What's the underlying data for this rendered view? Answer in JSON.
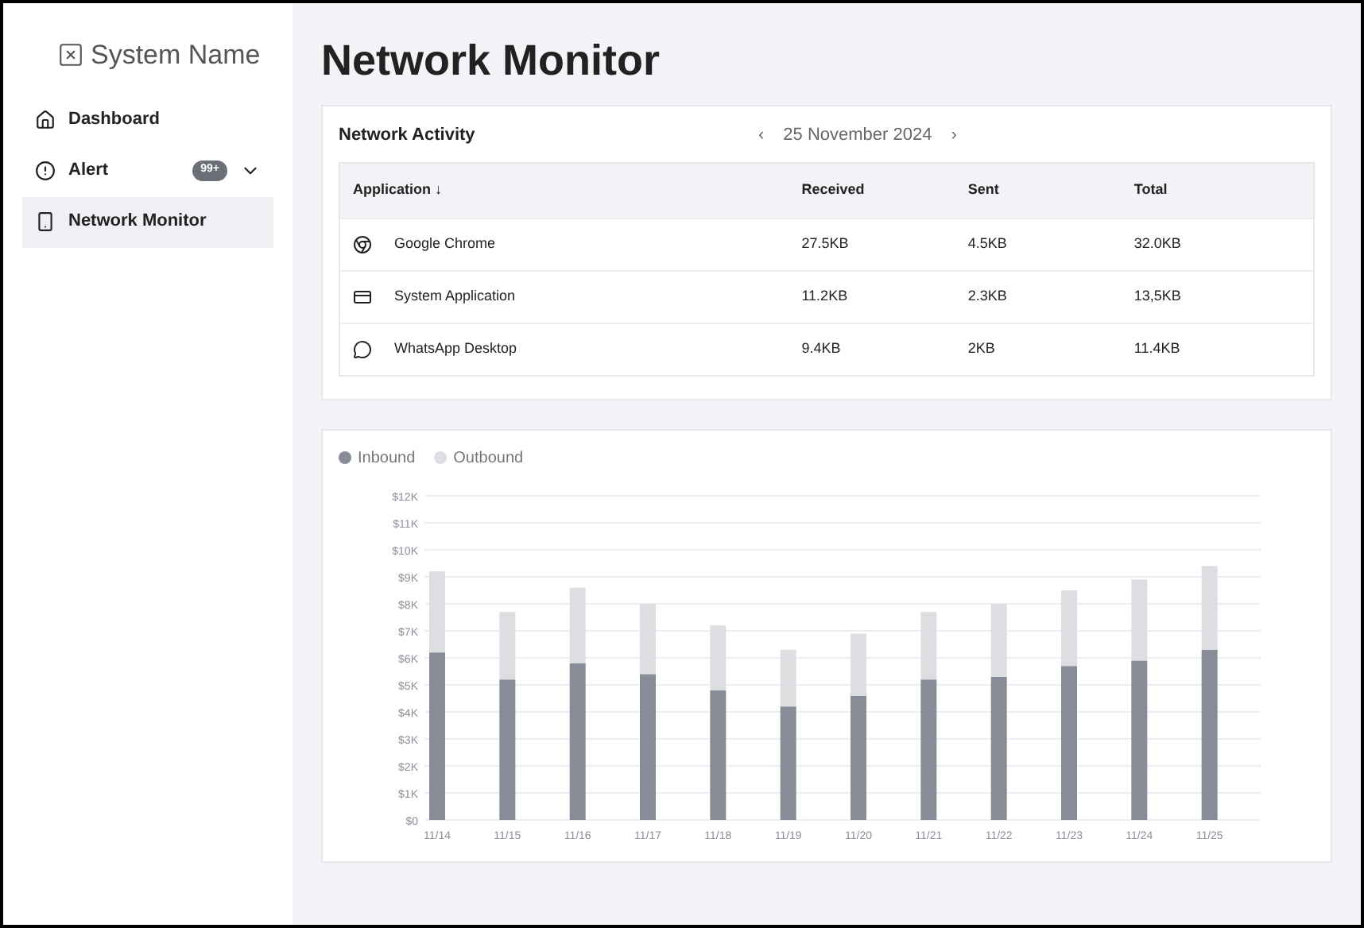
{
  "sidebar": {
    "brand": "System Name",
    "items": [
      {
        "kind": "home",
        "label": "Dashboard",
        "selected": false
      },
      {
        "kind": "alert",
        "label": "Alert",
        "badge": "99+",
        "expanded": false,
        "selected": false
      },
      {
        "kind": "monitor",
        "label": "Network Monitor",
        "selected": true
      }
    ]
  },
  "page_title": "Network Monitor",
  "activity": {
    "title": "Network Activity",
    "date": "25 November 2024",
    "prev": "‹",
    "next": "›",
    "columns": [
      {
        "label": "Application",
        "sort": "↓"
      },
      {
        "label": "Received"
      },
      {
        "label": "Sent"
      },
      {
        "label": "Total"
      }
    ],
    "rows": [
      {
        "kind": "browser",
        "cells": [
          "Google Chrome",
          "27.5KB",
          "4.5KB",
          "32.0KB"
        ]
      },
      {
        "kind": "system",
        "cells": [
          "System Application",
          "11.2KB",
          "2.3KB",
          "13,5KB"
        ]
      },
      {
        "kind": "chat",
        "cells": [
          "WhatsApp Desktop",
          "9.4KB",
          "2KB",
          "11.4KB"
        ]
      }
    ]
  },
  "traffic": {
    "chart_data": {
      "type": "bar",
      "stacked": true,
      "grid": true,
      "categories": [
        "11/14",
        "11/15",
        "11/16",
        "11/17",
        "11/18",
        "11/19",
        "11/20",
        "11/21",
        "11/22",
        "11/23",
        "11/24",
        "11/25"
      ],
      "series": [
        {
          "name": "Inbound",
          "color": "#878c96",
          "values": [
            6.2,
            5.2,
            5.8,
            5.4,
            4.8,
            4.2,
            4.6,
            5.2,
            5.3,
            5.7,
            5.9,
            6.3
          ]
        },
        {
          "name": "Outbound",
          "color": "#dcdee2",
          "values": [
            3.0,
            2.5,
            2.8,
            2.6,
            2.4,
            2.1,
            2.3,
            2.5,
            2.7,
            2.8,
            3.0,
            3.1
          ]
        }
      ],
      "ylim": [
        0,
        12
      ],
      "yticks": [
        {
          "value": 0,
          "label": "$0"
        },
        {
          "value": 1,
          "label": "$1K"
        },
        {
          "value": 2,
          "label": "$2K"
        },
        {
          "value": 3,
          "label": "$3K"
        },
        {
          "value": 4,
          "label": "$4K"
        },
        {
          "value": 5,
          "label": "$5K"
        },
        {
          "value": 6,
          "label": "$6K"
        },
        {
          "value": 7,
          "label": "$7K"
        },
        {
          "value": 8,
          "label": "$8K"
        },
        {
          "value": 9,
          "label": "$9K"
        },
        {
          "value": 10,
          "label": "$10K"
        },
        {
          "value": 11,
          "label": "$11K"
        },
        {
          "value": 12,
          "label": "$12K"
        }
      ]
    }
  }
}
